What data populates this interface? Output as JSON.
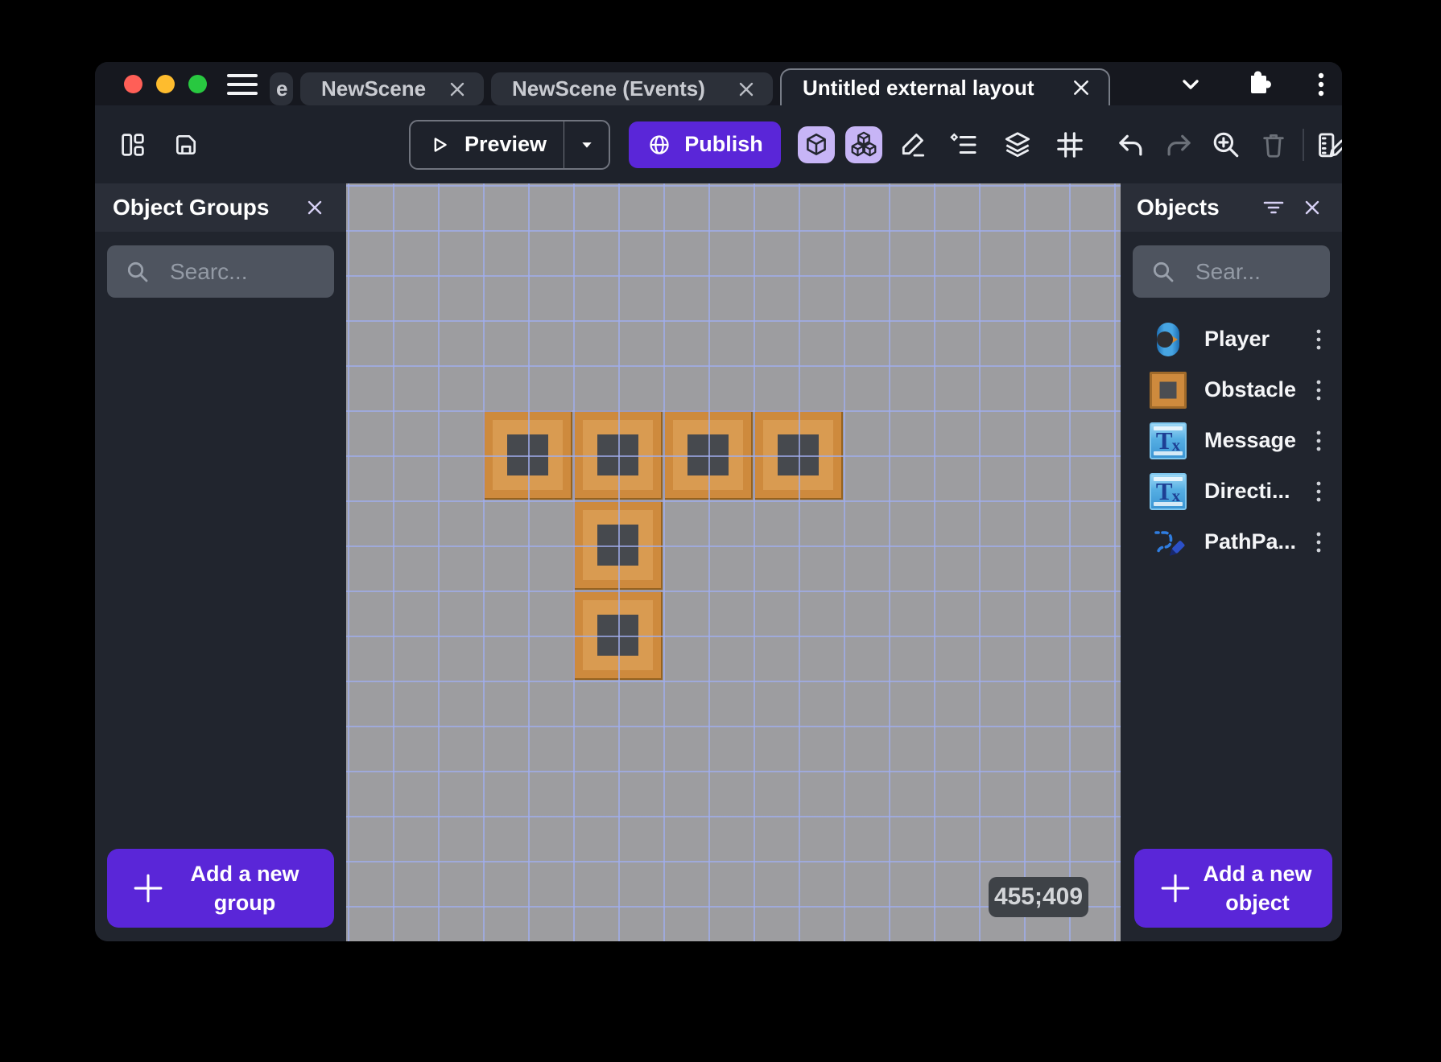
{
  "titlebar": {
    "tabs": [
      {
        "label": "e",
        "active": false
      },
      {
        "label": "NewScene",
        "active": false
      },
      {
        "label": "NewScene (Events)",
        "active": false
      },
      {
        "label": "Untitled external layout",
        "active": true
      }
    ],
    "traffic_lights": [
      "#ff5f57",
      "#febc2e",
      "#28c840"
    ]
  },
  "toolbar": {
    "preview_label": "Preview",
    "publish_label": "Publish"
  },
  "object_groups_panel": {
    "title": "Object Groups",
    "search_placeholder": "Searc...",
    "add_button_line1": "Add a new",
    "add_button_line2": "group"
  },
  "objects_panel": {
    "title": "Objects",
    "search_placeholder": "Sear...",
    "items": [
      {
        "name": "Player"
      },
      {
        "name": "Obstacle"
      },
      {
        "name": "Message"
      },
      {
        "name": "Directi..."
      },
      {
        "name": "PathPa..."
      }
    ],
    "add_button_line1": "Add a new",
    "add_button_line2": "object"
  },
  "canvas": {
    "cursor_coordinates": "455;409",
    "grid_size": 56,
    "grid_offset": [
      2,
      2
    ],
    "tile_size": 111,
    "tiles_grid": [
      {
        "col": 3,
        "row": 5
      },
      {
        "col": 5,
        "row": 5
      },
      {
        "col": 7,
        "row": 5
      },
      {
        "col": 9,
        "row": 5
      },
      {
        "col": 5,
        "row": 7
      },
      {
        "col": 5,
        "row": 9
      }
    ],
    "colors": {
      "background": "#9d9da0",
      "grid_line": "#a0aeee",
      "tile_orange": "#ce8a3d",
      "tile_light": "#d99b51",
      "tile_center": "#46494e"
    }
  },
  "theme": {
    "accent_purple": "#5a26d8",
    "toggle_lavender": "#c7b5f6",
    "toolbar_bg": "#1e222b",
    "panel_bg": "#21252e"
  }
}
